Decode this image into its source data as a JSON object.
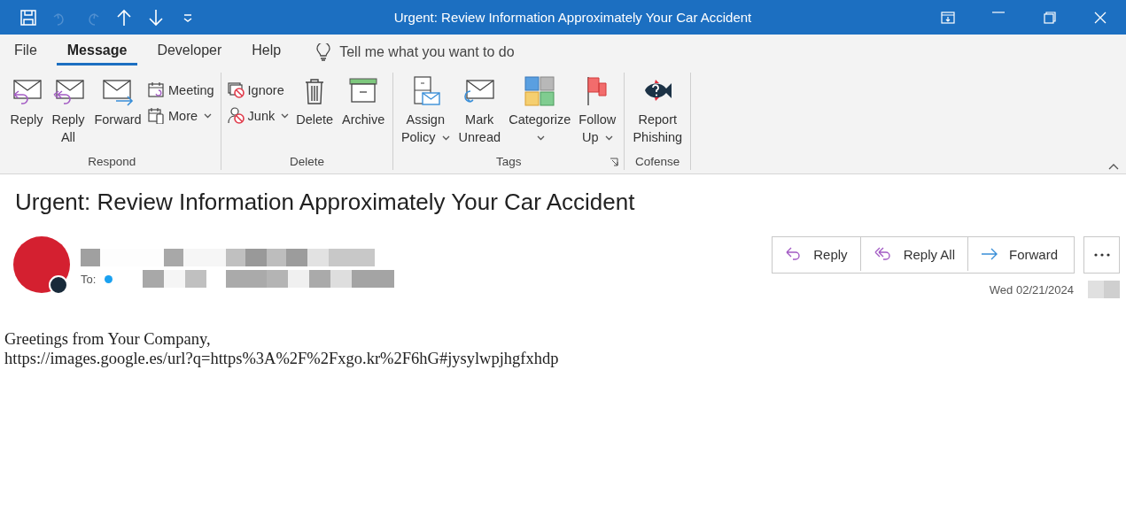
{
  "title_bar": {
    "quick_access": [
      {
        "disabled": false
      },
      {
        "disabled": true
      },
      {
        "disabled": true
      },
      {
        "disabled": false
      },
      {
        "disabled": false
      },
      {
        "disabled": false
      }
    ],
    "title": "Urgent: Review Information Approximately Your Car Accident"
  },
  "tabs": [
    {
      "label": "File",
      "selected": false
    },
    {
      "label": "Message",
      "selected": true
    },
    {
      "label": "Developer",
      "selected": false
    },
    {
      "label": "Help",
      "selected": false
    }
  ],
  "tell_me": {
    "placeholder": "Tell me what you want to do"
  },
  "ribbon": {
    "groups": [
      {
        "label": "Respond",
        "dialog_launcher": false,
        "items": [
          {
            "kind": "large",
            "label": "Reply",
            "dropdown": false
          },
          {
            "kind": "large",
            "label": "Reply All",
            "dropdown": false
          },
          {
            "kind": "large",
            "label": "Forward",
            "dropdown": false
          },
          {
            "kind": "stack",
            "buttons": [
              {
                "label": "Meeting",
                "dropdown": false
              },
              {
                "label": "More",
                "dropdown": true
              }
            ]
          }
        ]
      },
      {
        "label": "Delete",
        "dialog_launcher": false,
        "items": [
          {
            "kind": "stack",
            "buttons": [
              {
                "label": "Ignore",
                "dropdown": false
              },
              {
                "label": "Junk",
                "dropdown": true
              }
            ]
          },
          {
            "kind": "large",
            "label": "Delete",
            "dropdown": false
          },
          {
            "kind": "large",
            "label": "Archive",
            "dropdown": false
          }
        ]
      },
      {
        "label": "Tags",
        "dialog_launcher": true,
        "items": [
          {
            "kind": "large",
            "label": "Assign Policy",
            "dropdown": true
          },
          {
            "kind": "large",
            "label": "Mark Unread",
            "dropdown": false
          },
          {
            "kind": "large",
            "label": "Categorize",
            "dropdown": true
          },
          {
            "kind": "large",
            "label": "Follow Up",
            "dropdown": true
          }
        ]
      },
      {
        "label": "Cofense",
        "dialog_launcher": false,
        "items": [
          {
            "kind": "large",
            "label": "Report Phishing",
            "dropdown": false
          }
        ]
      }
    ]
  },
  "message": {
    "subject": "Urgent: Review Information Approximately Your Car Accident",
    "to_label": "To:",
    "actions": [
      {
        "label": "Reply"
      },
      {
        "label": "Reply All"
      },
      {
        "label": "Forward"
      }
    ],
    "date": "Wed 02/21/2024",
    "body": [
      "Greetings from Your Company,",
      "https://images.google.es/url?q=https%3A%2F%2Fxgo.kr%2F6hG#jysylwpjhgfxhdp"
    ]
  }
}
